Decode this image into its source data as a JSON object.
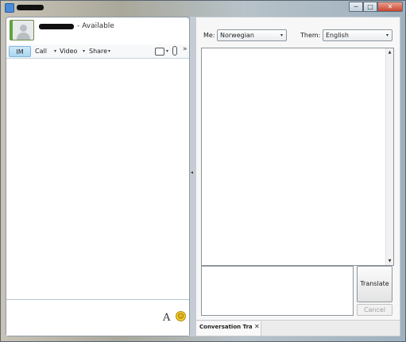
{
  "window": {
    "minimize_glyph": "─",
    "maximize_glyph": "□",
    "close_glyph": "✕"
  },
  "contact": {
    "status": "- Available"
  },
  "toolbar": {
    "im_label": "IM",
    "call_label": "Call",
    "video_label": "Video",
    "share_label": "Share",
    "caret": "▾",
    "more_glyph": "»"
  },
  "compose": {
    "font_glyph": "A",
    "emoticon_glyph": "☺"
  },
  "splitter": {
    "collapse_glyph": "◂"
  },
  "translator": {
    "me_label": "Me:",
    "me_language": "Norwegian",
    "them_label": "Them:",
    "them_language": "English",
    "select_caret": "▾",
    "scroll_up_glyph": "▲",
    "scroll_down_glyph": "▼",
    "translate_label": "Translate",
    "cancel_label": "Cancel"
  },
  "tabs": [
    {
      "label": "Conversation Tra...",
      "close_glyph": "✕"
    }
  ],
  "icons": {
    "app": "lync-app-icon",
    "avatar": "contact-avatar",
    "people": "people-options-icon",
    "attachment": "paperclip-icon",
    "font": "font-icon",
    "emoticon": "emoticon-icon"
  },
  "colors": {
    "presence_available": "#5ca83a",
    "im_tab_active": "#a9d6f1",
    "close_button": "#c9452e"
  }
}
